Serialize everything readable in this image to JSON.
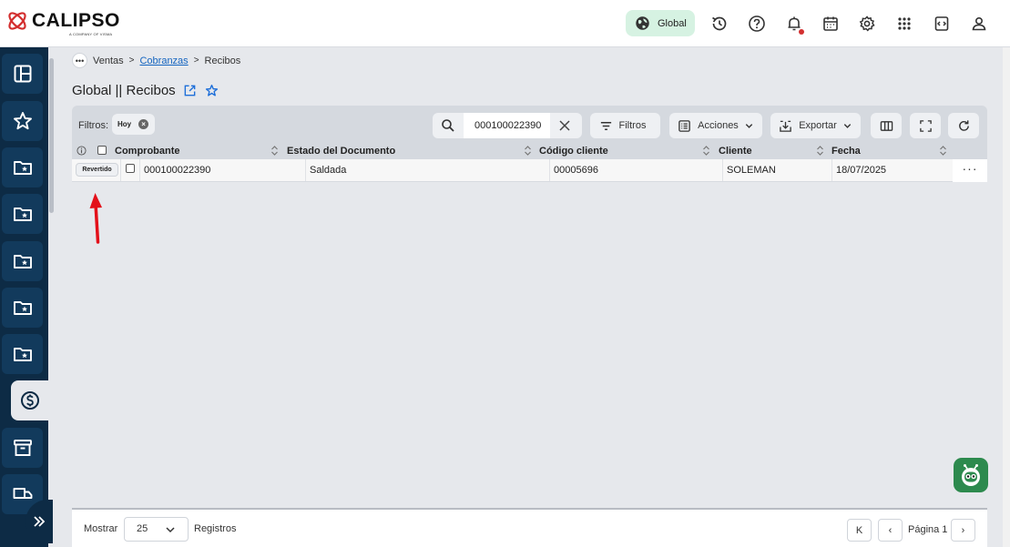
{
  "brand": {
    "name": "CALIPSO",
    "tagline": "A COMPANY OF VISMA",
    "accent_color": "#d32f2f",
    "sidebar_color": "#0d2b45"
  },
  "header": {
    "company_pill": "Global",
    "icons": [
      "history-icon",
      "help-icon",
      "bell-icon",
      "calendar-icon",
      "settings-icon",
      "apps-grid-icon",
      "code-window-icon",
      "user-icon"
    ]
  },
  "sidebar": {
    "items": [
      {
        "icon": "dashboard-icon"
      },
      {
        "icon": "star-icon"
      },
      {
        "icon": "folder-star-icon"
      },
      {
        "icon": "folder-star-icon"
      },
      {
        "icon": "folder-star-icon"
      },
      {
        "icon": "folder-star-icon"
      },
      {
        "icon": "folder-star-icon"
      },
      {
        "icon": "dollar-circle-icon",
        "active": true
      },
      {
        "icon": "archive-icon"
      },
      {
        "icon": "truck-icon"
      }
    ]
  },
  "breadcrumb": {
    "dots": "•••",
    "items": [
      "Ventas",
      "Cobranzas",
      "Recibos"
    ],
    "separator": ">"
  },
  "page": {
    "title": "Global || Recibos"
  },
  "toolbar": {
    "filters_label": "Filtros:",
    "filter_chip": "Hoy",
    "search_value": "000100022390",
    "filters_button": "Filtros",
    "actions_button": "Acciones",
    "export_button": "Exportar"
  },
  "table": {
    "columns": [
      "Comprobante",
      "Estado del Documento",
      "Código cliente",
      "Cliente",
      "Fecha"
    ],
    "rows": [
      {
        "status_button": "Revertido",
        "comprobante": "000100022390",
        "estado": "Saldada",
        "codigo_cliente": "00005696",
        "cliente": "SOLEMAN",
        "fecha": "18/07/2025",
        "more": "···"
      }
    ]
  },
  "footer": {
    "show_label": "Mostrar",
    "page_size": "25",
    "records_label": "Registros",
    "first_page": "K",
    "prev_page": "‹",
    "page_label": "Página 1",
    "next_page": "›"
  }
}
